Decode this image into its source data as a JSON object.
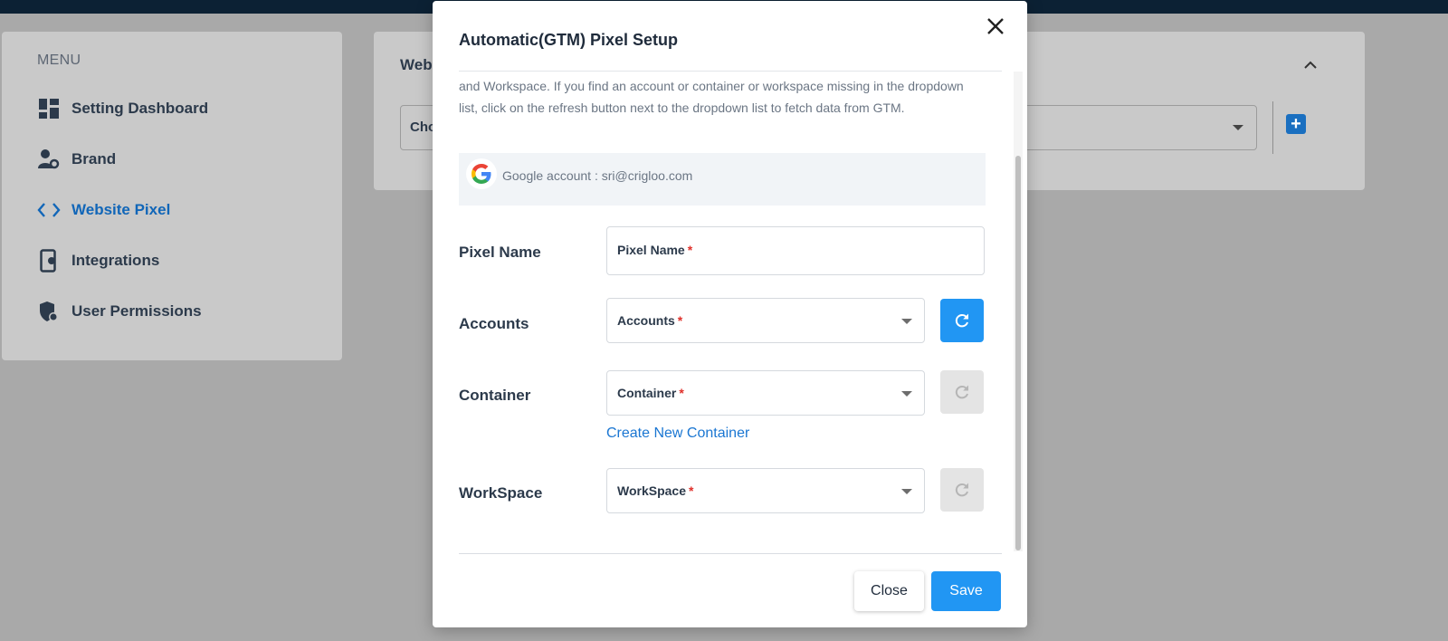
{
  "sidebar": {
    "heading": "MENU",
    "items": [
      {
        "label": "Setting Dashboard",
        "icon": "dashboard-icon"
      },
      {
        "label": "Brand",
        "icon": "user-gear-icon"
      },
      {
        "label": "Website Pixel",
        "icon": "code-icon",
        "active": true
      },
      {
        "label": "Integrations",
        "icon": "device-gear-icon"
      },
      {
        "label": "User Permissions",
        "icon": "shield-user-icon"
      }
    ]
  },
  "panel": {
    "title": "Web",
    "select_text": "Cho"
  },
  "modal": {
    "title": "Automatic(GTM) Pixel Setup",
    "description": "and Workspace. If you find an account or container or workspace missing in the dropdown list, click on the refresh button next to the dropdown list to fetch data from GTM.",
    "google_account": "Google account : sri@crigloo.com",
    "pixel_name": {
      "label": "Pixel Name",
      "placeholder": "Pixel Name",
      "required": "*"
    },
    "accounts": {
      "label": "Accounts",
      "placeholder": "Accounts",
      "required": "*"
    },
    "container": {
      "label": "Container",
      "placeholder": "Container",
      "required": "*",
      "create_link": "Create New Container"
    },
    "workspace": {
      "label": "WorkSpace",
      "placeholder": "WorkSpace",
      "required": "*"
    },
    "close_label": "Close",
    "save_label": "Save"
  },
  "colors": {
    "accent": "#2196f3",
    "active_nav": "#1166b8",
    "required": "#e0302a",
    "topbar": "#0c2134"
  }
}
